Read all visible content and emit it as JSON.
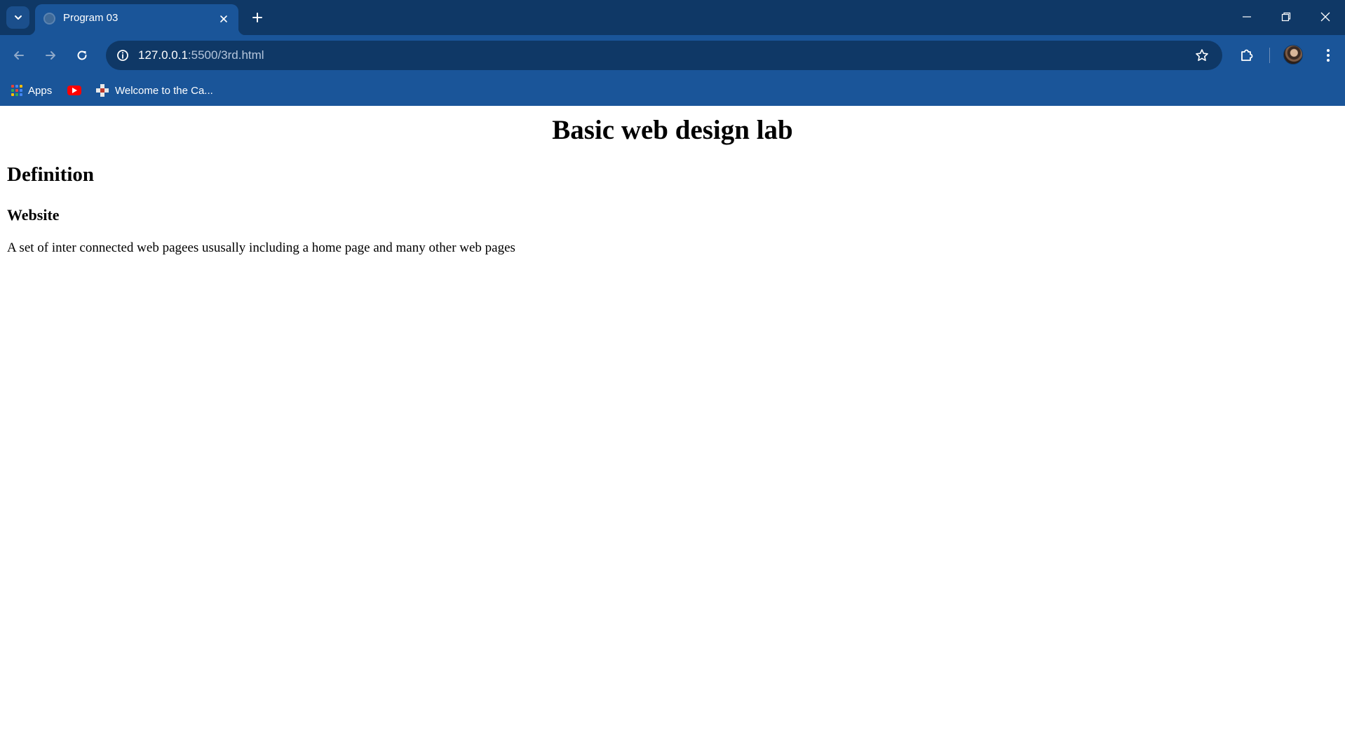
{
  "browser": {
    "tab": {
      "title": "Program 03"
    },
    "address_bar": {
      "host": "127.0.0.1",
      "path": ":5500/3rd.html"
    },
    "bookmarks": [
      {
        "label": "Apps",
        "icon": "apps-grid-icon"
      },
      {
        "label": "",
        "icon": "youtube-icon"
      },
      {
        "label": "Welcome to the Ca...",
        "icon": "red-cross-icon"
      }
    ],
    "colors": {
      "tabstrip": "#0f3866",
      "toolbar": "#1a5599",
      "omnibox": "#0f3866"
    }
  },
  "page": {
    "heading": "Basic web design lab",
    "section_heading": "Definition",
    "term": "Website",
    "definition": "A set of inter connected web pagees ususally including a home page and many other web pages"
  }
}
